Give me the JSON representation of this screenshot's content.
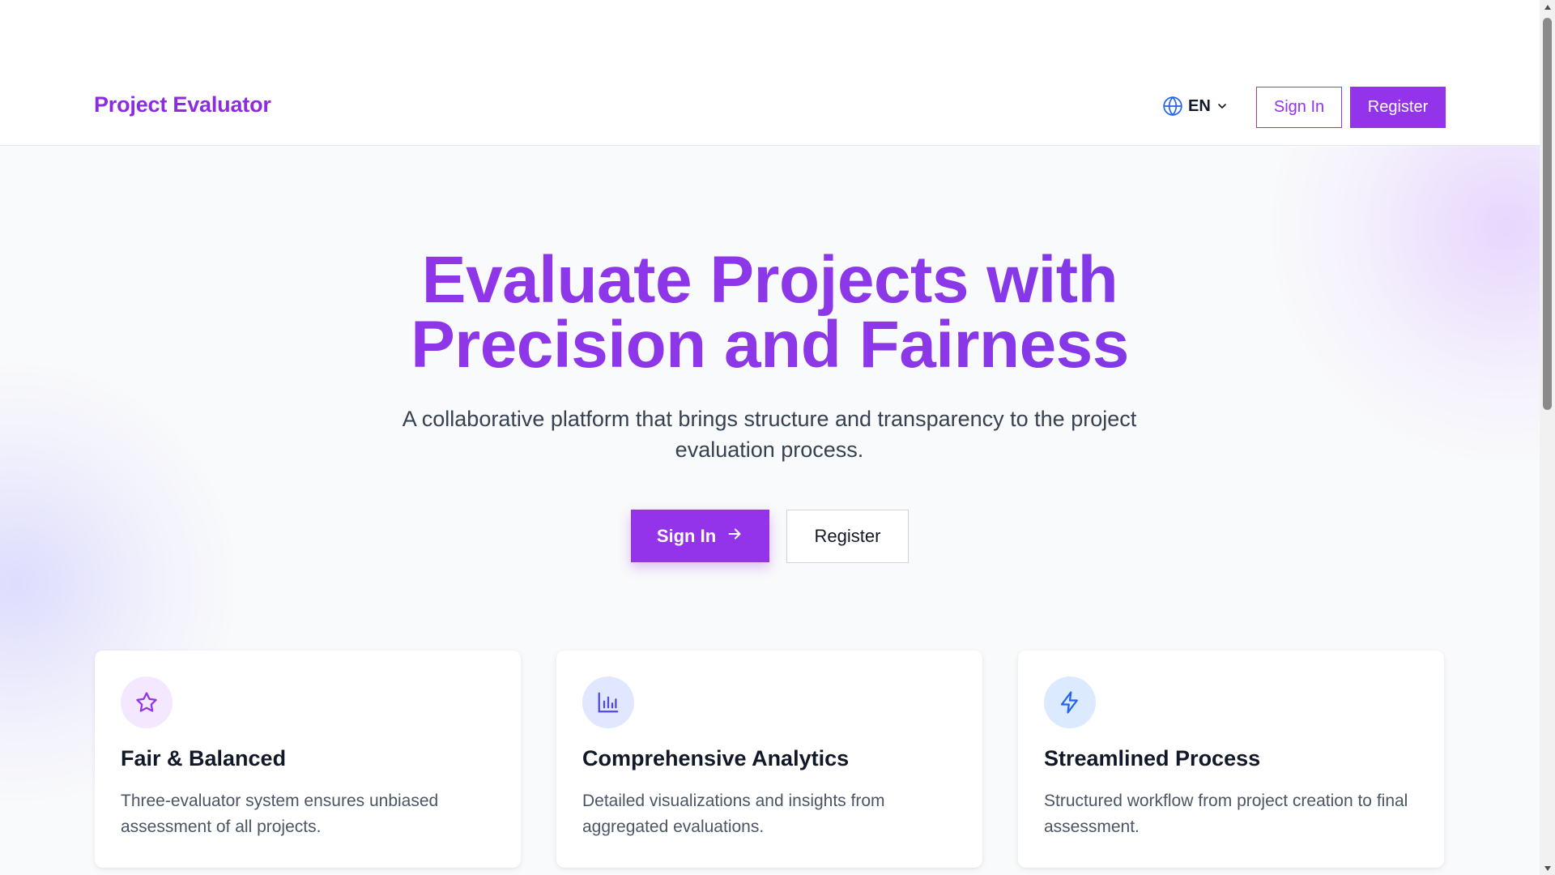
{
  "header": {
    "logo": "Project Evaluator",
    "language": "EN",
    "sign_in": "Sign In",
    "register": "Register"
  },
  "hero": {
    "title_line1": "Evaluate Projects with",
    "title_line2": "Precision and Fairness",
    "subtitle": "A collaborative platform that brings structure and transparency to the project evaluation process.",
    "sign_in": "Sign In",
    "register": "Register"
  },
  "features": [
    {
      "icon": "star-icon",
      "title": "Fair & Balanced",
      "description": "Three-evaluator system ensures unbiased assessment of all projects."
    },
    {
      "icon": "bar-chart-icon",
      "title": "Comprehensive Analytics",
      "description": "Detailed visualizations and insights from aggregated evaluations."
    },
    {
      "icon": "lightning-icon",
      "title": "Streamlined Process",
      "description": "Structured workflow from project creation to final assessment."
    }
  ],
  "colors": {
    "brand": "#9333ea",
    "brand_dark": "#6f3ae5",
    "text": "#111827",
    "muted": "#4b5563",
    "background": "#f9fafb"
  }
}
